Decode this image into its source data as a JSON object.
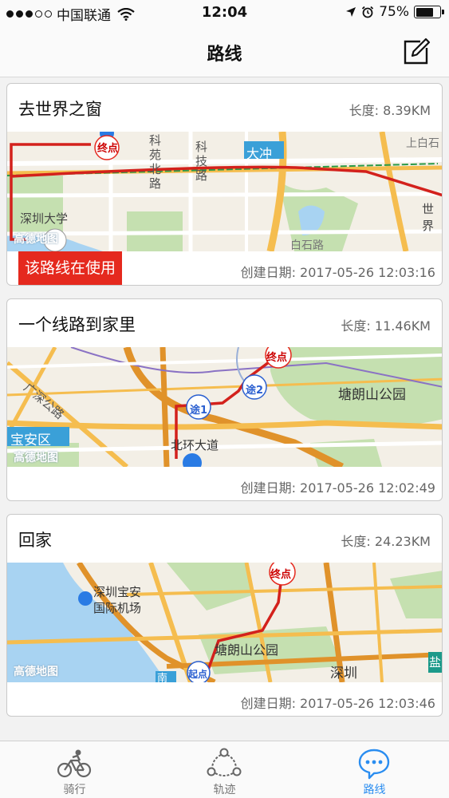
{
  "status_bar": {
    "carrier": "中国联通",
    "time": "12:04",
    "battery_percent": "75%",
    "battery_level": 0.75,
    "signal_bars_filled": 3,
    "signal_bars_total": 5
  },
  "nav": {
    "title": "路线",
    "edit_icon": "edit-square-icon"
  },
  "routes": [
    {
      "name": "去世界之窗",
      "length": "长度: 8.39KM",
      "in_use_label": "该路线在使用",
      "created": "创建日期: 2017-05-26 12:03:16",
      "map": {
        "labels": [
          "科苑北路",
          "科技路",
          "大冲",
          "上白石",
          "深圳大学",
          "世界",
          "白石路"
        ],
        "end_marker": "终点",
        "watermark": "高德地图"
      }
    },
    {
      "name": "一个线路到家里",
      "length": "长度: 11.46KM",
      "created": "创建日期: 2017-05-26 12:02:49",
      "map": {
        "labels": [
          "广深公路",
          "塘朗山公园",
          "宝安区",
          "北环大道"
        ],
        "end_marker": "终点",
        "via_markers": [
          "途1",
          "途2"
        ],
        "watermark": "高德地图"
      }
    },
    {
      "name": "回家",
      "length": "长度: 24.23KM",
      "created": "创建日期: 2017-05-26 12:03:46",
      "map": {
        "labels": [
          "深圳宝安",
          "国际机场",
          "塘朗山公园",
          "深圳",
          "南",
          "盐"
        ],
        "end_marker": "终点",
        "start_marker": "起点",
        "watermark": "高德地图"
      }
    }
  ],
  "tabs": [
    {
      "label": "骑行",
      "icon": "bicycle-icon",
      "active": false
    },
    {
      "label": "轨迹",
      "icon": "track-icon",
      "active": false
    },
    {
      "label": "路线",
      "icon": "chat-route-icon",
      "active": true
    }
  ],
  "colors": {
    "accent": "#2a8df0",
    "in_use_badge": "#e5291e",
    "route_line": "#d3211c",
    "map_green": "#c5e0b0",
    "map_water": "#a8d3f2",
    "map_road": "#f5bd4f"
  }
}
